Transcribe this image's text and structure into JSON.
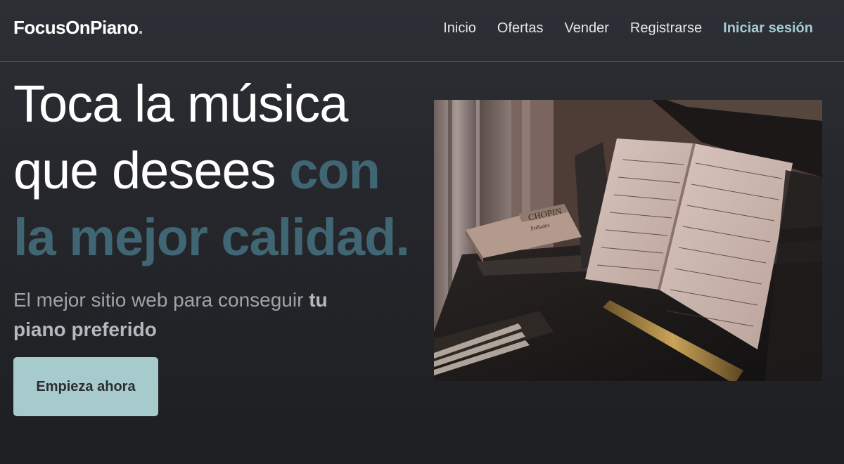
{
  "brand": {
    "name": "FocusOnPiano",
    "dot": "."
  },
  "nav": {
    "items": [
      "Inicio",
      "Ofertas",
      "Vender",
      "Registrarse"
    ],
    "login": "Iniciar sesión"
  },
  "hero": {
    "title_plain": "Toca la música que desees ",
    "title_accent": "con la mejor calidad.",
    "subtitle_plain": "El mejor sitio web para conseguir ",
    "subtitle_bold": "tu piano preferido",
    "cta": "Empieza ahora"
  },
  "image": {
    "description_icon": "piano-sheet-music-photo",
    "book_cover_text": "CHOPIN",
    "book_cover_sub": "Préludes"
  },
  "colors": {
    "background": "#25272c",
    "accent_text": "#3f6672",
    "button": "#a7cacd",
    "login_link": "#a6cccf"
  }
}
